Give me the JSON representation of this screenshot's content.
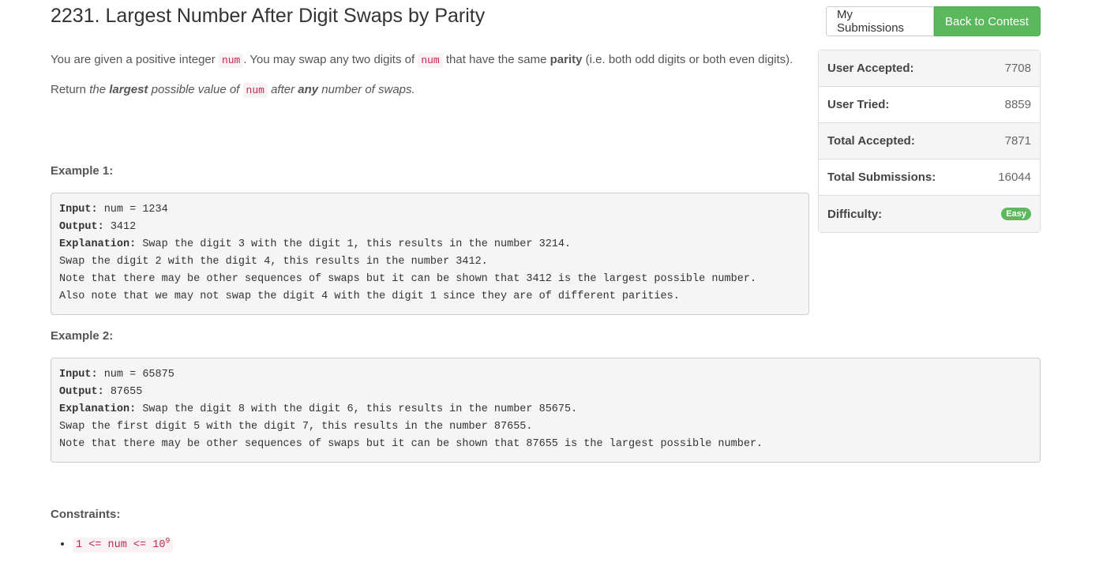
{
  "problem": {
    "title": "2231. Largest Number After Digit Swaps by Parity",
    "desc1_a": "You are given a positive integer ",
    "code_num": "num",
    "desc1_b": ". You may swap any two digits of ",
    "desc1_c": " that have the same ",
    "desc1_parity": "parity",
    "desc1_d": " (i.e. both odd digits or both even digits).",
    "desc2_a": "Return ",
    "desc2_the": "the ",
    "desc2_largest": "largest",
    "desc2_b": " possible value of ",
    "desc2_c": " after ",
    "desc2_any": "any",
    "desc2_d": " number of swaps."
  },
  "buttons": {
    "my_submissions": "My Submissions",
    "back_to_contest": "Back to Contest"
  },
  "examples": [
    {
      "heading": "Example 1:",
      "input_label": "Input:",
      "input": " num = 1234",
      "output_label": "Output:",
      "output": " 3412",
      "explanation_label": "Explanation:",
      "explanation": " Swap the digit 3 with the digit 1, this results in the number 3214.\nSwap the digit 2 with the digit 4, this results in the number 3412.\nNote that there may be other sequences of swaps but it can be shown that 3412 is the largest possible number.\nAlso note that we may not swap the digit 4 with the digit 1 since they are of different parities."
    },
    {
      "heading": "Example 2:",
      "input_label": "Input:",
      "input": " num = 65875",
      "output_label": "Output:",
      "output": " 87655",
      "explanation_label": "Explanation:",
      "explanation": " Swap the digit 8 with the digit 6, this results in the number 85675.\nSwap the first digit 5 with the digit 7, this results in the number 87655.\nNote that there may be other sequences of swaps but it can be shown that 87655 is the largest possible number."
    }
  ],
  "constraints": {
    "heading": "Constraints:",
    "item_base": "1 <= num <= 10",
    "item_exp": "9"
  },
  "stats": [
    {
      "label": "User Accepted:",
      "value": "7708"
    },
    {
      "label": "User Tried:",
      "value": "8859"
    },
    {
      "label": "Total Accepted:",
      "value": "7871"
    },
    {
      "label": "Total Submissions:",
      "value": "16044"
    },
    {
      "label": "Difficulty:",
      "value": "Easy"
    }
  ],
  "colors": {
    "success": "#5cb85c",
    "code": "#c7254e"
  }
}
